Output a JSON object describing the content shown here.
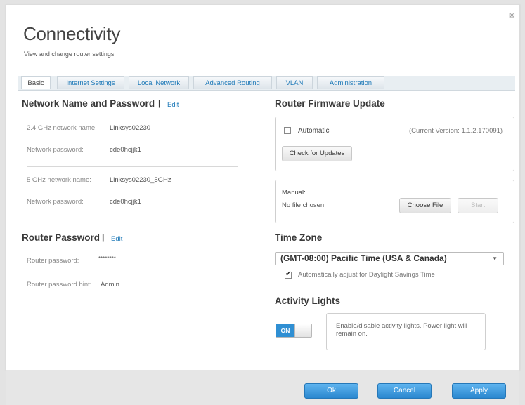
{
  "window": {
    "close_glyph": "⊠"
  },
  "header": {
    "title": "Connectivity",
    "subtitle": "View and change router settings"
  },
  "tabs": [
    {
      "label": "Basic",
      "active": true
    },
    {
      "label": "Internet Settings",
      "active": false
    },
    {
      "label": "Local Network",
      "active": false
    },
    {
      "label": "Advanced Routing",
      "active": false
    },
    {
      "label": "VLAN",
      "active": false
    },
    {
      "label": "Administration",
      "active": false
    }
  ],
  "network": {
    "heading": "Network Name and Password",
    "separator": "|",
    "edit_label": "Edit",
    "band24": {
      "name_label": "2.4 GHz network name:",
      "name_value": "Linksys02230",
      "pw_label": "Network password:",
      "pw_value": "cde0hcjjk1"
    },
    "band5": {
      "name_label": "5 GHz network name:",
      "name_value": "Linksys02230_5GHz",
      "pw_label": "Network password:",
      "pw_value": "cde0hcjjk1"
    }
  },
  "router_password": {
    "heading": "Router Password",
    "separator": "|",
    "edit_label": "Edit",
    "pw_label": "Router password:",
    "pw_value": "********",
    "hint_label": "Router password hint:",
    "hint_value": "Admin"
  },
  "firmware": {
    "heading": "Router Firmware Update",
    "automatic_label": "Automatic",
    "automatic_checked": false,
    "current_version": "(Current Version: 1.1.2.170091)",
    "check_button": "Check for Updates",
    "manual_label": "Manual:",
    "file_status": "No file chosen",
    "choose_button": "Choose File",
    "start_button": "Start"
  },
  "timezone": {
    "heading": "Time Zone",
    "selected": "(GMT-08:00) Pacific Time (USA & Canada)",
    "caret": "▼",
    "dst_label": "Automatically adjust for Daylight Savings Time",
    "dst_checked": true
  },
  "activity_lights": {
    "heading": "Activity Lights",
    "toggle_label": "ON",
    "toggle_on": true,
    "description": "Enable/disable activity lights. Power light will remain on."
  },
  "footer": {
    "ok_label": "Ok",
    "cancel_label": "Cancel",
    "apply_label": "Apply"
  },
  "colors": {
    "accent_blue": "#2a87cf",
    "link_blue": "#1f7ab8",
    "heading_dark": "#3a3a3a"
  }
}
